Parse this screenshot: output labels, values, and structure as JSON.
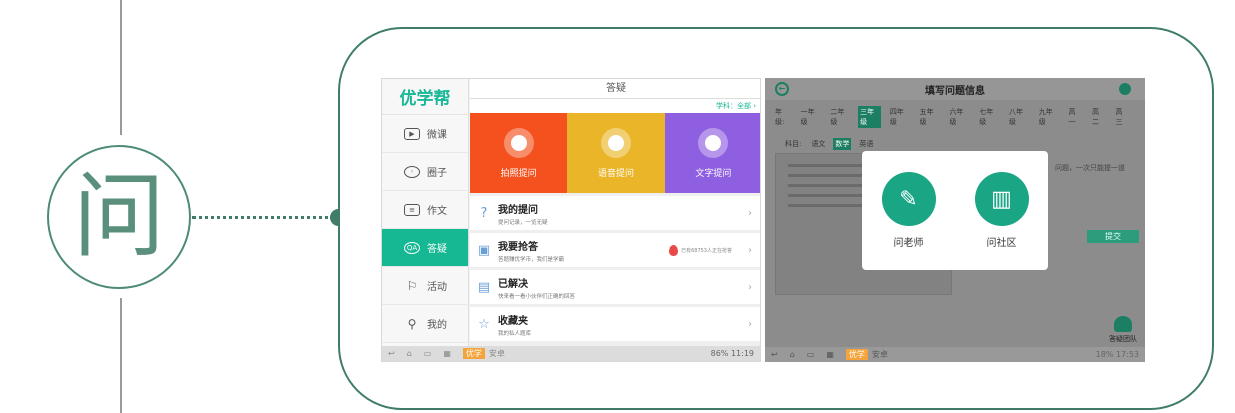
{
  "badge": {
    "char": "问"
  },
  "left_tablet": {
    "logo": "优学帮",
    "nav": [
      {
        "label": "微课",
        "icon": "video-icon"
      },
      {
        "label": "圈子",
        "icon": "planet-icon"
      },
      {
        "label": "作文",
        "icon": "document-icon"
      },
      {
        "label": "答疑",
        "icon": "qa-icon",
        "active": true
      },
      {
        "label": "活动",
        "icon": "flag-icon"
      },
      {
        "label": "我的",
        "icon": "person-icon"
      }
    ],
    "header_title": "答疑",
    "subject_filter": "学科：全部",
    "tiles": [
      {
        "label": "拍照提问",
        "color": "#f4511e",
        "icon": "camera-icon"
      },
      {
        "label": "语音提问",
        "color": "#eab529",
        "icon": "microphone-icon"
      },
      {
        "label": "文字提问",
        "color": "#8e5fe0",
        "icon": "text-icon"
      }
    ],
    "rows": [
      {
        "title": "我的提问",
        "sub": "提问记录，一览无疑",
        "icon": "question-icon"
      },
      {
        "title": "我要抢答",
        "sub": "答题赚优学币，我们是学霸",
        "icon": "answer-icon",
        "hot": "已有68753人正在抢答"
      },
      {
        "title": "已解决",
        "sub": "快来看一看小伙伴们正确的回答",
        "icon": "list-icon"
      },
      {
        "title": "收藏夹",
        "sub": "我的私人题库",
        "icon": "star-icon"
      }
    ],
    "bar": {
      "yx": "优学",
      "az": "安卓",
      "time": "11:19",
      "battery": "86%"
    }
  },
  "right_tablet": {
    "title": "填写问题信息",
    "grades": [
      "年级:",
      "一年级",
      "二年级",
      "三年级",
      "四年级",
      "五年级",
      "六年级",
      "七年级",
      "八年级",
      "九年级",
      "高一",
      "高二",
      "高三"
    ],
    "selected_grade": "三年级",
    "subjects": [
      "科目:",
      "语文",
      "数学",
      "英语"
    ],
    "selected_subject": "数学",
    "hint": "问题，一次只能提一道",
    "submit": "提交",
    "modal": {
      "teacher": "问老师",
      "community": "问社区"
    },
    "team": "答疑团队",
    "bar": {
      "yx": "优学",
      "az": "安卓",
      "time": "17:53",
      "battery": "18%"
    }
  }
}
